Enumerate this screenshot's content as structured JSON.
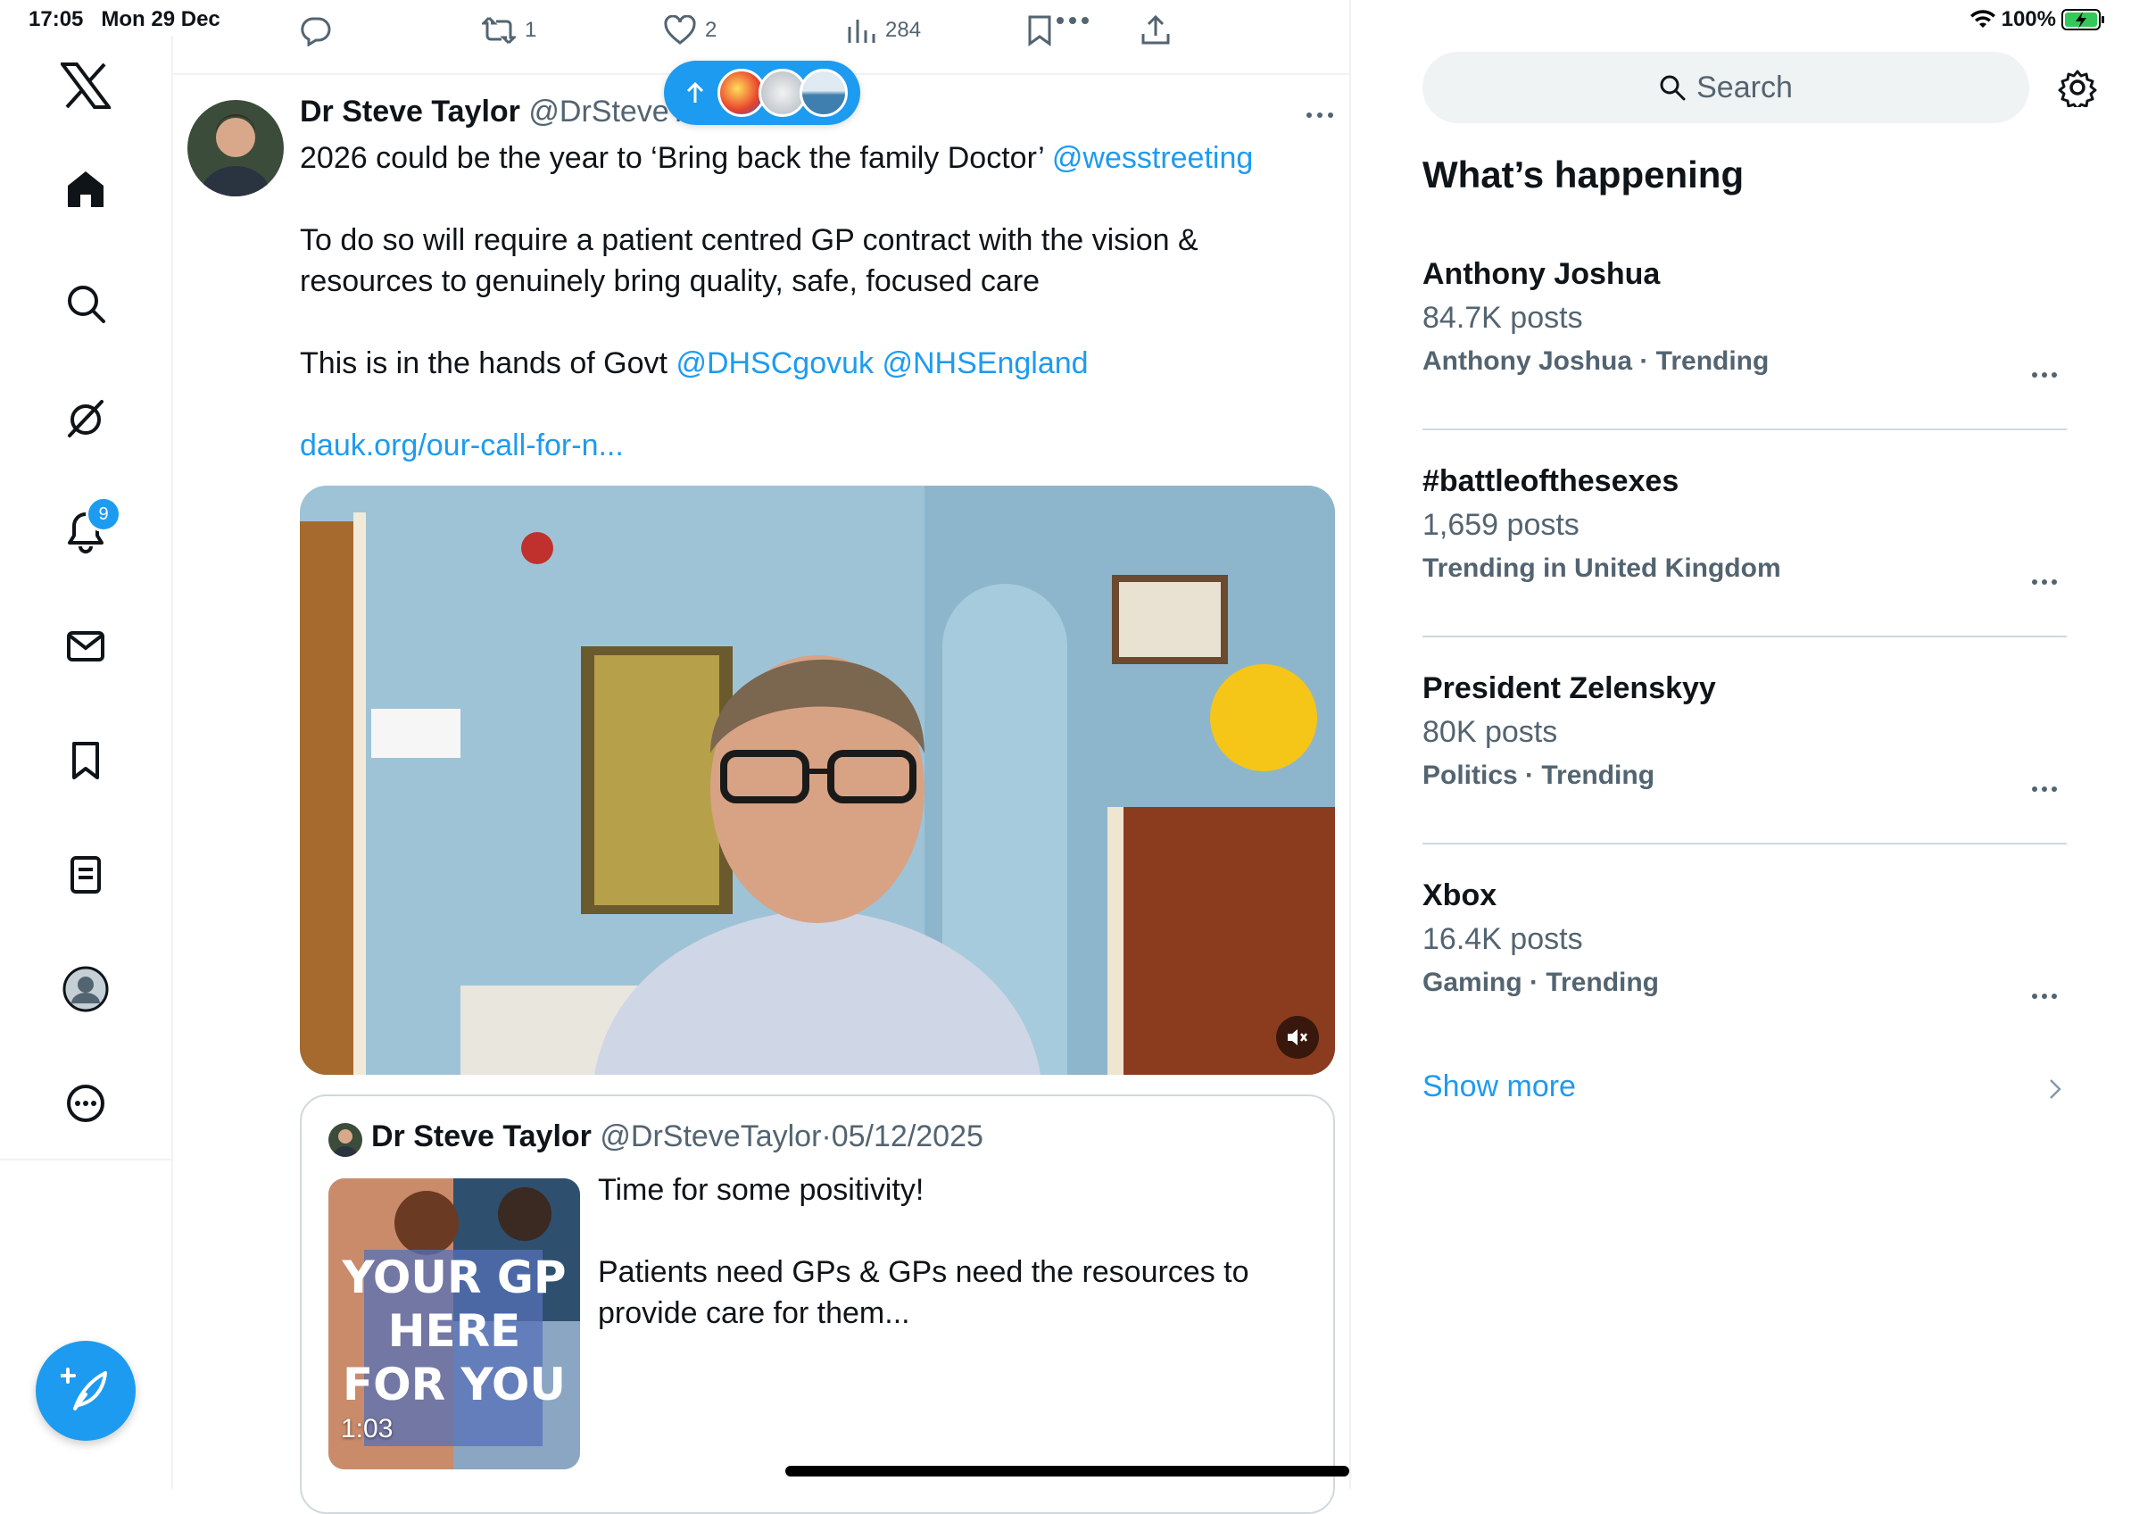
{
  "status_bar": {
    "time": "17:05",
    "date": "Mon 29 Dec",
    "battery": "100%"
  },
  "nav": {
    "notifications_badge": "9"
  },
  "prev_actions": {
    "retweets": "1",
    "likes": "2",
    "views": "284"
  },
  "tweet": {
    "author_name": "Dr Steve Taylor",
    "author_handle": "@DrSteveTa",
    "line1": "2026 could be the year to ‘Bring back the family Doctor’ ",
    "mention1": "@wesstreeting",
    "line2": "To do so will require a patient centred GP contract with the vision & resources to genuinely bring quality, safe, focused care",
    "line3": "This is in the hands of Govt ",
    "mention2": "@DHSCgovuk",
    "mention3": "@NHSEngland",
    "url": "dauk.org/our-call-for-n..."
  },
  "quote": {
    "author_name": "Dr Steve Taylor",
    "author_handle": "@DrSteveTaylor",
    "separator": "·",
    "date": "05/12/2025",
    "text1": "Time for some positivity!",
    "text2": "Patients need GPs & GPs need the resources to provide care for them...",
    "duration": "1:03",
    "thumb_lines": [
      "YOUR GP",
      "HERE",
      "FOR YOU"
    ]
  },
  "search": {
    "placeholder": "Search"
  },
  "whats_happening": {
    "title": "What’s happening",
    "trends": [
      {
        "name": "Anthony Joshua",
        "count": "84.7K posts",
        "context": "Anthony Joshua · Trending"
      },
      {
        "name": "#battleofthesexes",
        "count": "1,659 posts",
        "context": "Trending in United Kingdom"
      },
      {
        "name": "President Zelenskyy",
        "count": "80K posts",
        "context": "Politics · Trending"
      },
      {
        "name": "Xbox",
        "count": "16.4K posts",
        "context": "Gaming · Trending"
      }
    ],
    "show_more": "Show more"
  },
  "colors": {
    "accent": "#1d9bf0",
    "muted": "#536471",
    "text": "#0f1419"
  }
}
